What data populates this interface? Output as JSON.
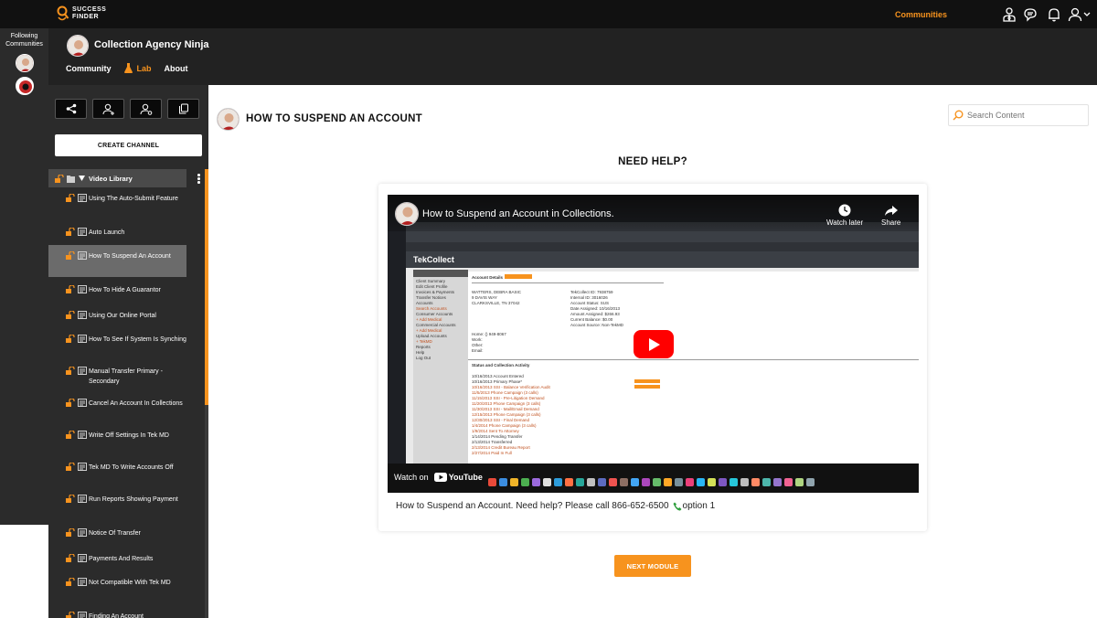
{
  "topbar": {
    "logo_line1": "SUCCESS",
    "logo_line2": "FINDER",
    "communities_link": "Communities",
    "icons": [
      "user-tie-icon",
      "chat-bubbles-icon",
      "bell-icon",
      "user-menu-icon"
    ]
  },
  "rail": {
    "following_label": "Following Communities"
  },
  "community": {
    "title": "Collection Agency Ninja",
    "tabs": [
      "Community",
      "Lab",
      "About"
    ],
    "active_tab": "Lab"
  },
  "sidebar": {
    "actions": [
      "share-icon",
      "add-user-icon",
      "user-settings-icon",
      "copy-icon"
    ],
    "create_channel": "CREATE CHANNEL",
    "library_label": "Video Library",
    "items": [
      "Using The Auto-Submit Feature",
      "Auto Launch",
      "How To Suspend An Account",
      "How To Hide A Guarantor",
      "Using Our Online Portal",
      "How To See If System Is Synching",
      "Manual Transfer Primary - Secondary",
      "Cancel An Account In Collections",
      "Write Off Settings In Tek MD",
      "Tek MD To Write Accounts Off",
      "Run Reports Showing Payment",
      "Notice Of Transfer",
      "Payments And Results",
      "Not Compatible With Tek MD",
      "Finding An Account"
    ],
    "active_index": 2
  },
  "main": {
    "title": "HOW TO SUSPEND AN ACCOUNT",
    "search_placeholder": "Search Content",
    "need_help": "NEED HELP?",
    "caption_text": "How to Suspend an Account. Need help? Please call 866-652-6500",
    "caption_suffix": "option 1",
    "next_button": "NEXT MODULE"
  },
  "video": {
    "title": "How to Suspend an Account in Collections.",
    "watch_later": "Watch later",
    "share": "Share",
    "watch_on": "Watch on",
    "youtube": "YouTube",
    "app_logo": "TekCollect",
    "sidebar_links": [
      "Client Summary",
      "Edit Client Profile",
      "Invoices & Payments",
      "Transfer Notices",
      "Accounts",
      "Search Accounts",
      "Consumer Accounts",
      "+ Add Medical",
      "Commercial Accounts",
      "+ Add Medical",
      "Upload Accounts",
      "+ TekMD",
      "Reports",
      "Help",
      "Log Out"
    ],
    "account_details": "Account Details",
    "debtor_block": [
      "WATTERS, DEBRA BASIC",
      "9 DAVIS WAY",
      "CLARKSVILLE, TN 37042"
    ],
    "info_block": [
      "TekCollect ID: 7938759",
      "Internal ID: 3016026",
      "Account Status: SUS",
      "Date Assigned: 10/16/2013",
      "Amount Assigned: $266.93",
      "Current Balance: $0.00",
      "Account Source: Non-TekMD"
    ],
    "contact_block": [
      "Home: () 949-8067",
      "Work:",
      "Other:",
      "Email:"
    ],
    "activity_header": "Status and Collection Activity",
    "activity": [
      "10/16/2013  Account Entered",
      "10/16/2013  Primary Phase*",
      "10/16/2013  SSI - Balance Verification Audit",
      "11/5/2013  Phone Campaign (3 calls)",
      "11/15/2013  SSI - Pre-Litigation Demand",
      "11/20/2013  Phone Campaign (3 calls)",
      "11/30/2013  SSI - Mail/Email Demand",
      "12/15/2013  Phone Campaign (3 calls)",
      "12/30/2013  SSI - Final Demand",
      "1/4/2014  Phone Campaign (3 calls)",
      "1/9/2014  Sent To Attorney",
      "1/14/2014  Pending Transfer",
      "2/13/2014  Transferred",
      "2/13/2014  Credit Bureau Report",
      "2/27/2014  Paid In Full"
    ]
  }
}
